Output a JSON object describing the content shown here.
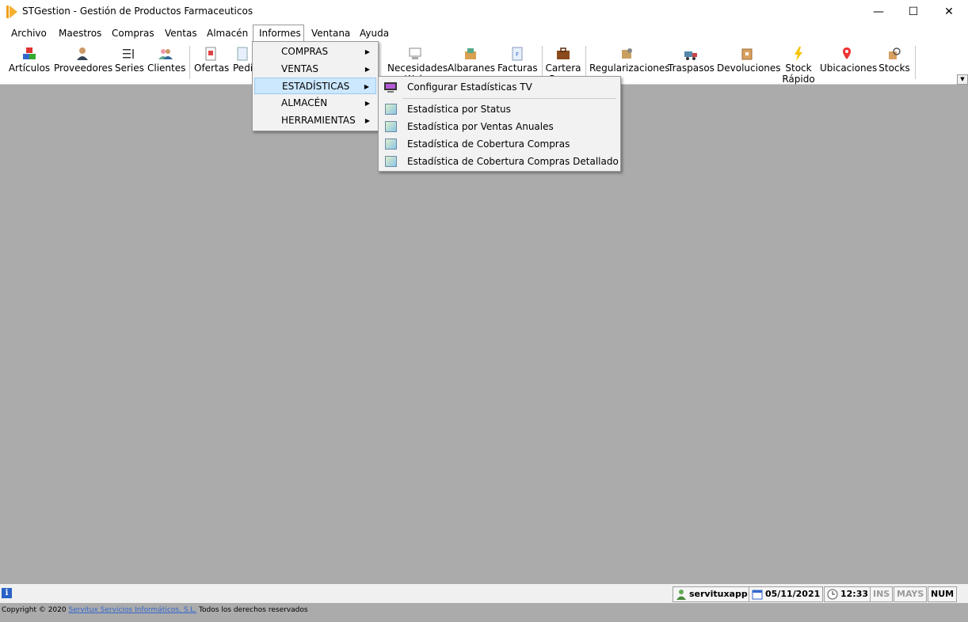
{
  "window": {
    "title": "STGestion - Gestión de Productos Farmaceuticos",
    "minimize_glyph": "—",
    "maximize_glyph": "☐",
    "close_glyph": "✕"
  },
  "menubar": {
    "items": [
      "Archivo",
      "Maestros",
      "Compras",
      "Ventas",
      "Almacén",
      "Informes",
      "Ventana",
      "Ayuda"
    ]
  },
  "toolbar": {
    "items": [
      {
        "label": "Artículos",
        "icon": "articles-icon"
      },
      {
        "label": "Proveedores",
        "icon": "supplier-icon"
      },
      {
        "label": "Series",
        "icon": "series-icon"
      },
      {
        "label": "Clientes",
        "icon": "clients-icon"
      },
      {
        "label": "Ofertas",
        "icon": "offers-icon"
      },
      {
        "label": "Pedi",
        "icon": "orders-icon"
      },
      {
        "label": "Necesidades Web",
        "icon": "web-needs-icon"
      },
      {
        "label": "Albaranes",
        "icon": "delivery-notes-icon"
      },
      {
        "label": "Facturas",
        "icon": "invoices-icon"
      },
      {
        "label": "Cartera Pagos",
        "icon": "briefcase-icon"
      },
      {
        "label": "Regularizaciones",
        "icon": "adjustments-icon"
      },
      {
        "label": "Traspasos",
        "icon": "transfers-icon"
      },
      {
        "label": "Devoluciones",
        "icon": "returns-icon"
      },
      {
        "label": "Stock Rápido",
        "icon": "lightning-icon"
      },
      {
        "label": "Ubicaciones",
        "icon": "location-pin-icon"
      },
      {
        "label": "Stocks",
        "icon": "search-stock-icon"
      }
    ]
  },
  "informes_menu": {
    "items": [
      "COMPRAS",
      "VENTAS",
      "ESTADÍSTICAS",
      "ALMACÉN",
      "HERRAMIENTAS"
    ],
    "highlighted": "ESTADÍSTICAS"
  },
  "estadisticas_submenu": {
    "items": [
      "Configurar Estadísticas TV",
      "Estadística por Status",
      "Estadística por Ventas Anuales",
      "Estadística de Cobertura Compras",
      "Estadística de Cobertura Compras Detallado"
    ]
  },
  "statusbar": {
    "user": "servituxapp",
    "date": "05/11/2021",
    "time": "12:33",
    "ins": "INS",
    "mays": "MAYS",
    "num": "NUM"
  },
  "footer": {
    "prefix": "Copyright © 2020",
    "company": "Servitux Servicios Informáticos, S.L.",
    "suffix": "Todos los derechos reservados"
  }
}
